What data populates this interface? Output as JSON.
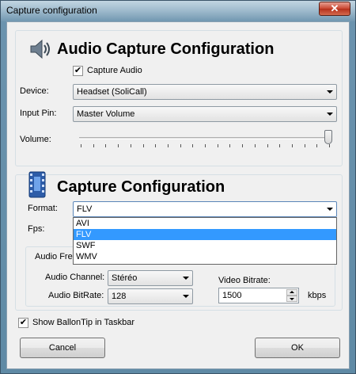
{
  "window": {
    "title": "Capture configuration",
    "close_glyph": "✕"
  },
  "audio": {
    "heading": "Audio Capture Configuration",
    "icon": "speaker-icon",
    "capture_audio_label": "Capture Audio",
    "capture_audio_checked": true,
    "device_label": "Device:",
    "device_value": "Headset (SoliCall)",
    "input_pin_label": "Input Pin:",
    "input_pin_value": "Master Volume",
    "volume_label": "Volume:",
    "volume_level": 1.0
  },
  "capture": {
    "heading": "Capture Configuration",
    "icon": "film-icon",
    "format_label": "Format:",
    "format_value": "FLV",
    "format_options": [
      "AVI",
      "FLV",
      "SWF",
      "WMV"
    ],
    "format_selected_index": 1,
    "fps_label": "Fps:",
    "audio_frequency_label": "Audio Fre",
    "audio_channel_label": "Audio Channel:",
    "audio_channel_value": "Stéréo",
    "audio_bitrate_label": "Audio BitRate:",
    "audio_bitrate_value": "128",
    "video_bitrate_label": "Video Bitrate:",
    "video_bitrate_value": "1500",
    "video_bitrate_unit": "kbps"
  },
  "show_balloontip_label": "Show BallonTip in Taskbar",
  "show_balloontip_checked": true,
  "buttons": {
    "cancel": "Cancel",
    "ok": "OK"
  },
  "colors": {
    "selection": "#3399ff",
    "window_frame": "#6b93ae"
  }
}
